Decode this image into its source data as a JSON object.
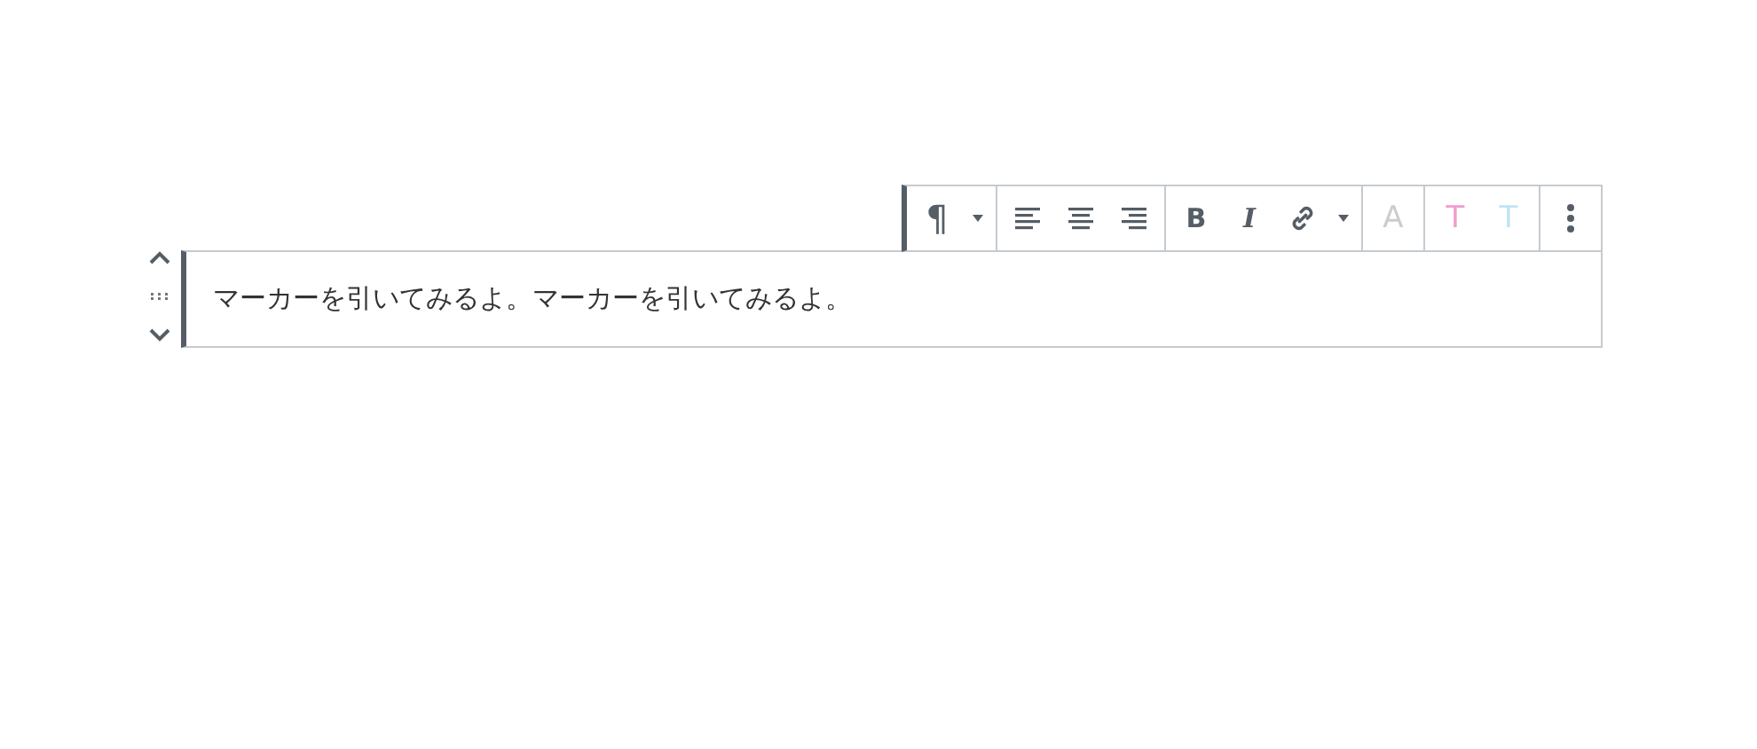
{
  "toolbar": [
    {
      "items": [
        {
          "kind": "glyph",
          "label": "¶"
        },
        {
          "kind": "caret"
        }
      ]
    },
    {
      "items": [
        {
          "kind": "align-left"
        },
        {
          "kind": "align-center"
        },
        {
          "kind": "align-right"
        }
      ]
    },
    {
      "items": [
        {
          "kind": "bold",
          "label": "B"
        },
        {
          "kind": "italic",
          "label": "I"
        },
        {
          "kind": "link"
        },
        {
          "kind": "caret"
        }
      ]
    },
    {
      "items": [
        {
          "kind": "color-text",
          "label": "A",
          "color": "#cccccc"
        }
      ]
    },
    {
      "items": [
        {
          "kind": "color-text",
          "label": "T",
          "color": "#f09ccc"
        },
        {
          "kind": "color-text",
          "label": "T",
          "color": "#bfe3f5"
        }
      ]
    },
    {
      "items": [
        {
          "kind": "more"
        }
      ]
    }
  ],
  "paragraph": "マーカーを引いてみるよ。マーカーを引いてみるよ。"
}
